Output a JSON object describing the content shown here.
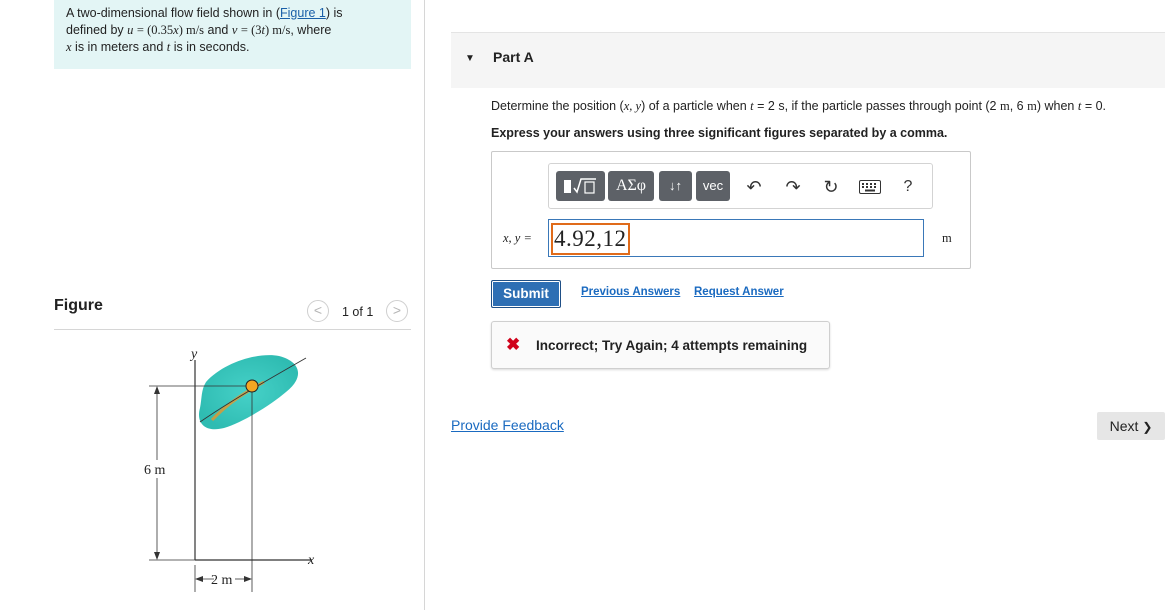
{
  "problem": {
    "line1_pre": "A two-dimensional flow field shown in (",
    "figure_link": "Figure 1",
    "line1_post": ") is",
    "line2_a": "defined by",
    "u_var": "u",
    "u_eq": "= (0.35",
    "x_var": "x",
    "u_unit": ") m/s",
    "and_word": "and",
    "v_var": "v",
    "v_eq": "= (3",
    "t_var": "t",
    "v_unit": ") m/s",
    "where": ", where",
    "line3_x": "x",
    "line3_mid": "is in meters and",
    "line3_t": "t",
    "line3_end": "is in seconds."
  },
  "figure_panel": {
    "heading": "Figure",
    "counter": "1 of 1",
    "prev_icon": "chevron-left-icon",
    "next_icon": "chevron-right-icon",
    "prev_glyph": "<",
    "next_glyph": ">",
    "labels": {
      "y_axis": "y",
      "x_axis": "x",
      "height": "6 m",
      "width": "2 m"
    },
    "colors": {
      "blob": "#3ec9c0",
      "particle": "#f5a623",
      "streak": "#e8962b"
    }
  },
  "part": {
    "caret": "▼",
    "title": "Part A",
    "question_pre": "Determine the position (",
    "q_xy": "x, y",
    "question_mid1": ") of a particle when",
    "q_t": "t",
    "question_mid2": "= 2 s, if the particle passes through point (2",
    "q_m1": "m",
    "question_mid3": ", 6",
    "q_m2": "m",
    "question_mid4": ") when",
    "q_t2": "t",
    "question_end": "= 0.",
    "instruction": "Express your answers using three significant figures separated by a comma."
  },
  "toolbar": {
    "templates_icon": "templates-icon",
    "templates_glyph": "▮√▯",
    "greek_label": "ΑΣφ",
    "arrows_label": "↓↑",
    "vec_label": "vec",
    "undo_icon": "undo-icon",
    "undo_glyph": "↶",
    "redo_icon": "redo-icon",
    "redo_glyph": "↷",
    "reset_icon": "reset-icon",
    "reset_glyph": "↻",
    "keyboard_icon": "keyboard-icon",
    "help_label": "?"
  },
  "answer": {
    "var_label": "x, y =",
    "value": "4.92,12",
    "unit": "m"
  },
  "actions": {
    "submit": "Submit",
    "previous_answers": "Previous Answers",
    "request_answer": "Request Answer"
  },
  "feedback": {
    "icon": "x-icon",
    "icon_glyph": "✖",
    "message": "Incorrect; Try Again; 4 attempts remaining",
    "color": "#d0021b"
  },
  "footer": {
    "provide_feedback": "Provide Feedback",
    "next_label": "Next",
    "next_glyph": "❯"
  },
  "colors": {
    "problem_bg": "#e3f5f5",
    "submit_bg": "#2e6fb4",
    "link": "#1a6ac0",
    "input_border": "#3a78b8",
    "answer_highlight": "#e06b1a"
  }
}
